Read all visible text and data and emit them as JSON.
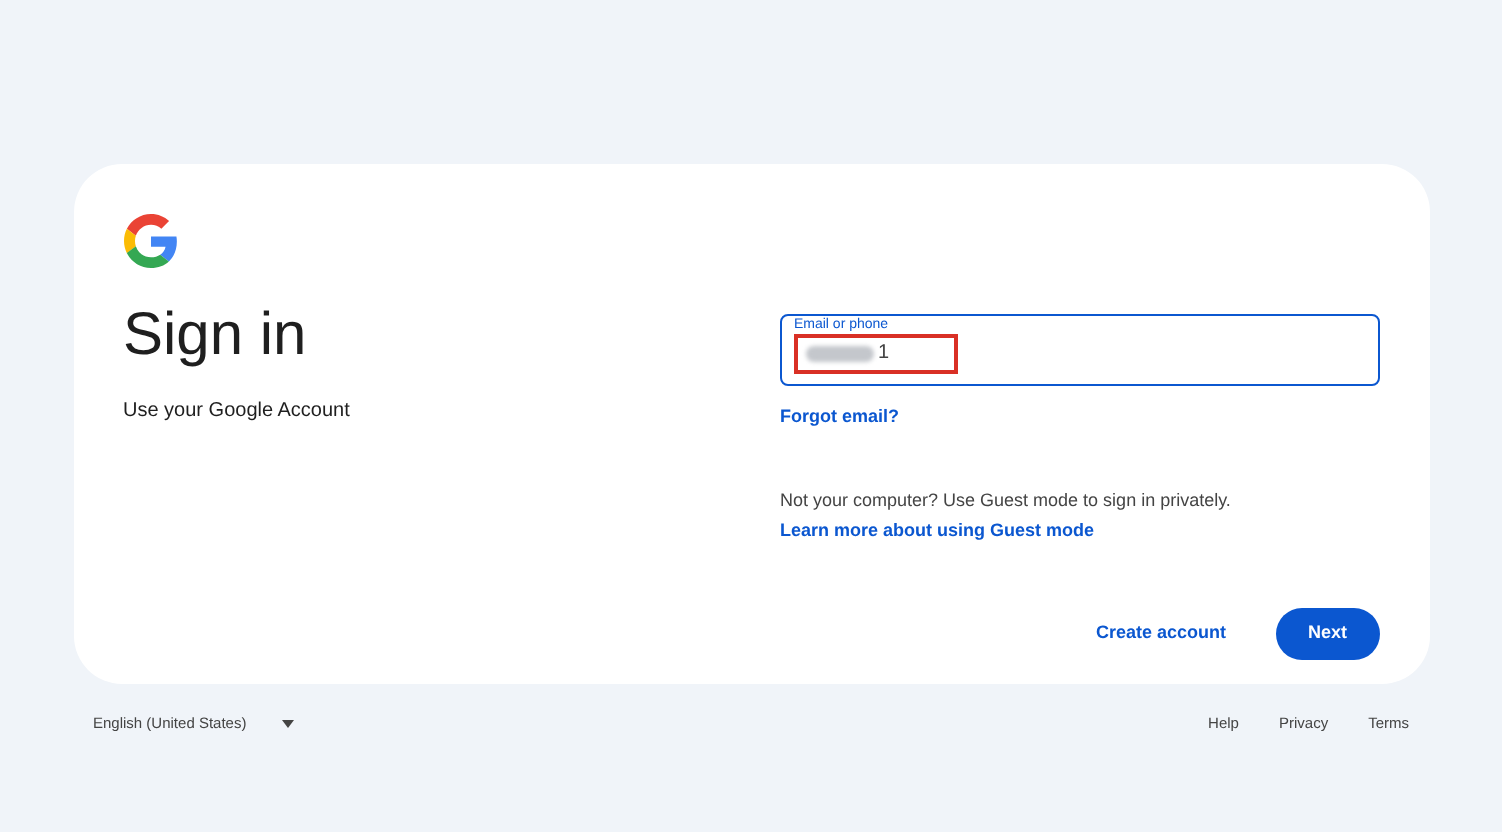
{
  "card": {
    "title": "Sign in",
    "subtitle": "Use your Google Account",
    "email_field": {
      "label": "Email or phone",
      "value": "1",
      "redacted": true,
      "highlighted": true
    },
    "forgot_link": "Forgot email?",
    "guest_note": {
      "text": "Not your computer? Use Guest mode to sign in privately.",
      "link": "Learn more about using Guest mode"
    },
    "buttons": [
      {
        "label": "Create account",
        "kind": "text"
      },
      {
        "label": "Next",
        "kind": "filled"
      }
    ]
  },
  "footer": {
    "language": "English (United States)",
    "links": [
      "Help",
      "Privacy",
      "Terms"
    ]
  }
}
